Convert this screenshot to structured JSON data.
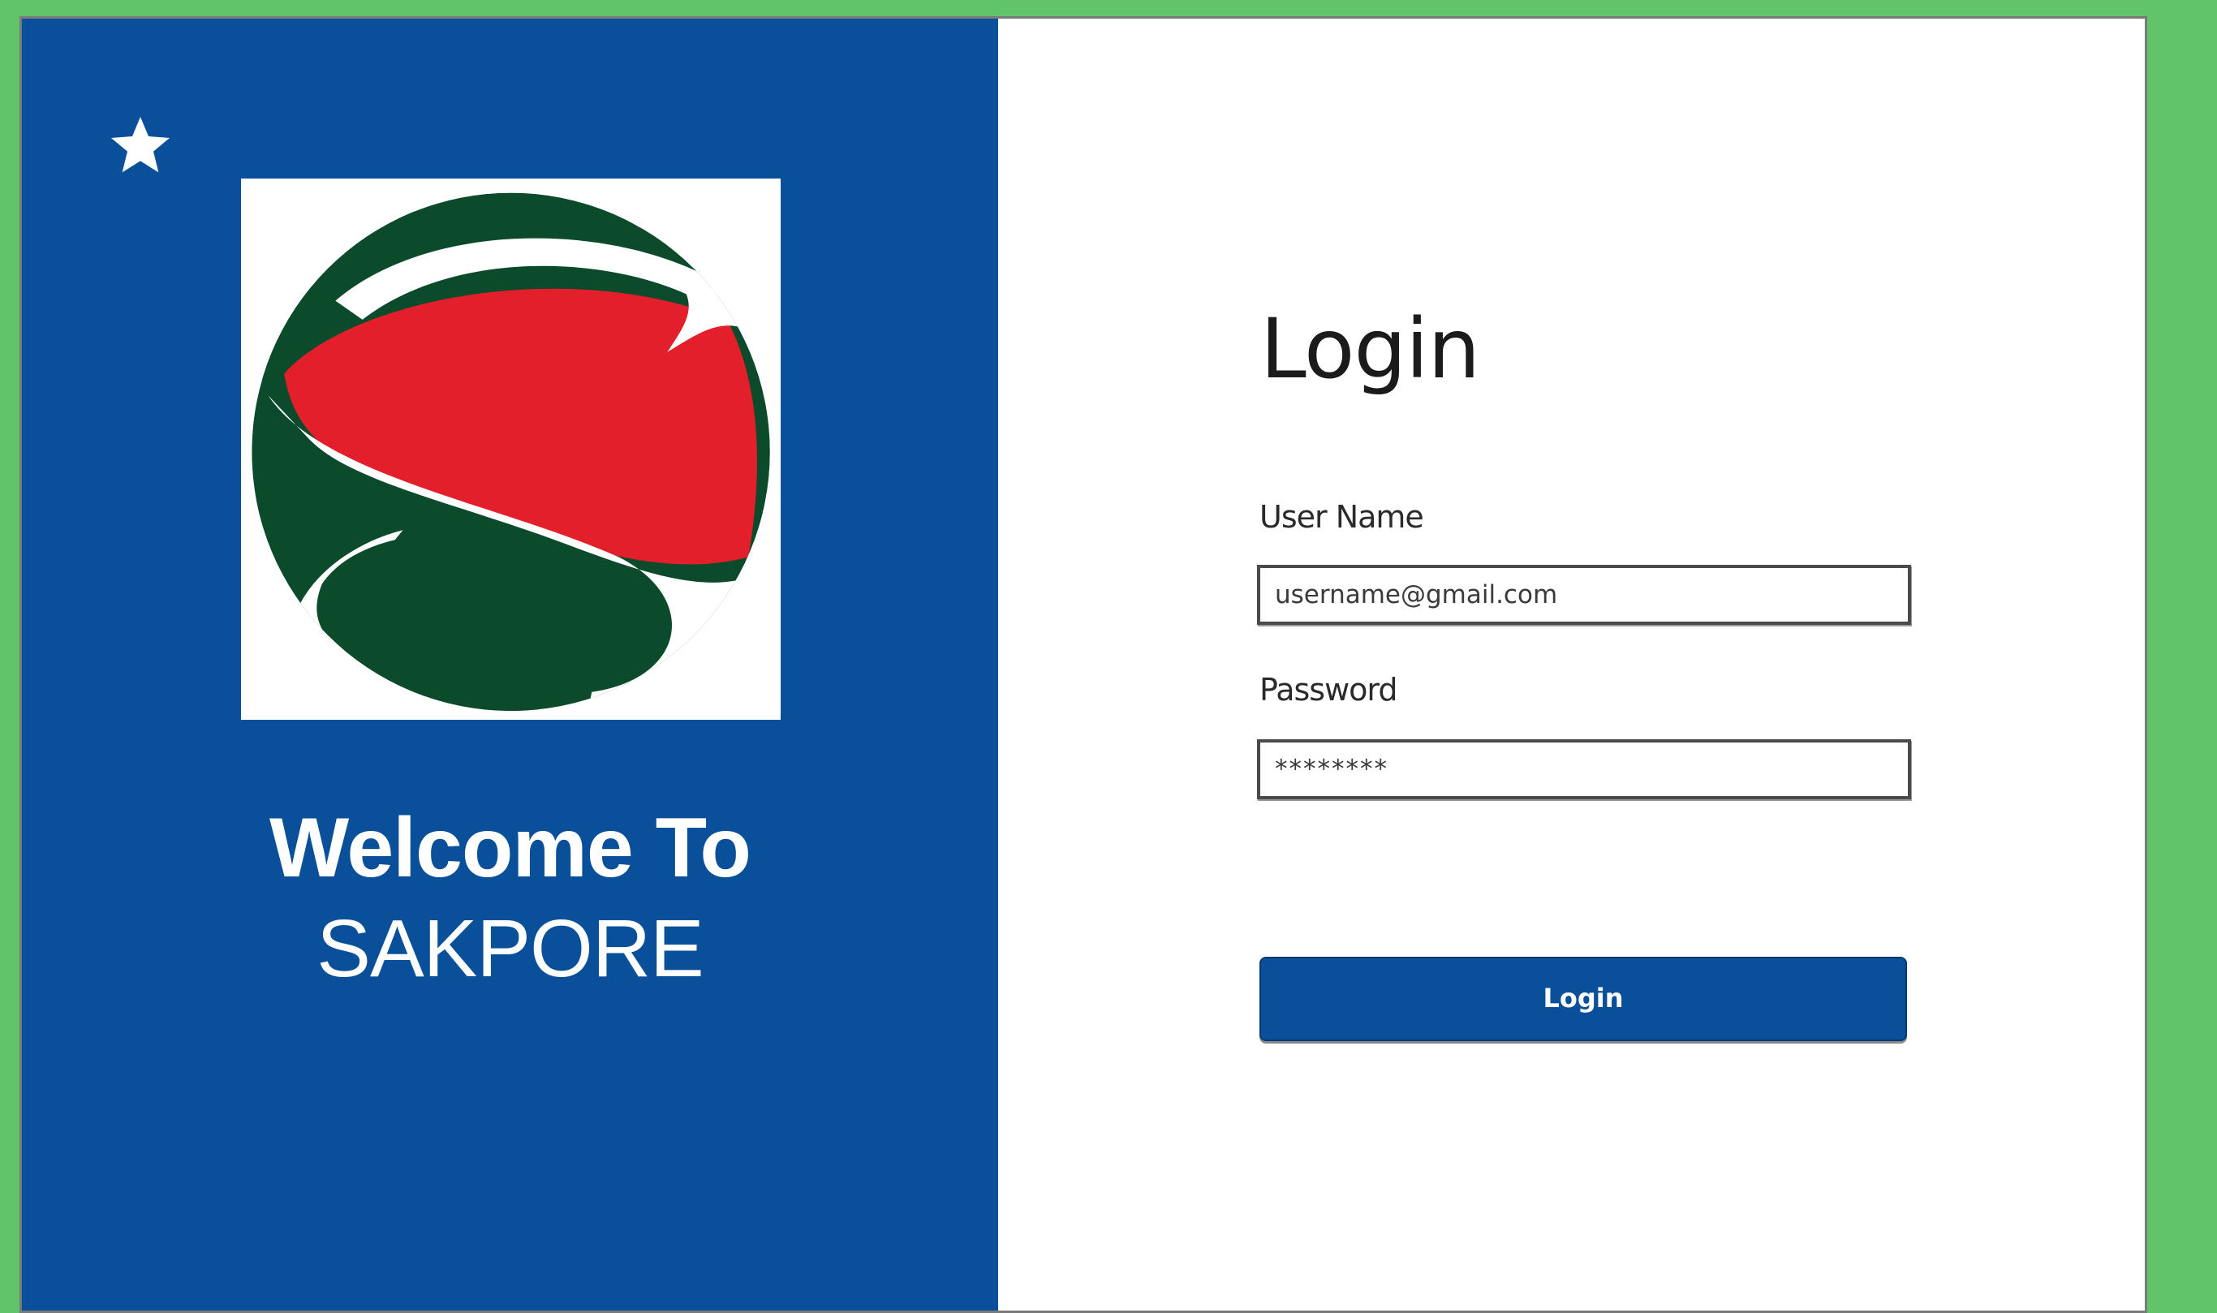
{
  "left_panel": {
    "welcome_line1": "Welcome To",
    "welcome_line2": "SAKPORE",
    "logo_letter": "S"
  },
  "login_form": {
    "title": "Login",
    "username_label": "User Name",
    "username_value": "username@gmail.com",
    "password_label": "Password",
    "password_value": "********",
    "submit_label": "Login"
  },
  "icons": {
    "star": "star-icon",
    "logo": "sakpore-logo"
  },
  "colors": {
    "primary_blue": "#0a4f99",
    "logo_red": "#e21f2a",
    "logo_green": "#0b4a2a",
    "background_green": "#62c46a"
  }
}
